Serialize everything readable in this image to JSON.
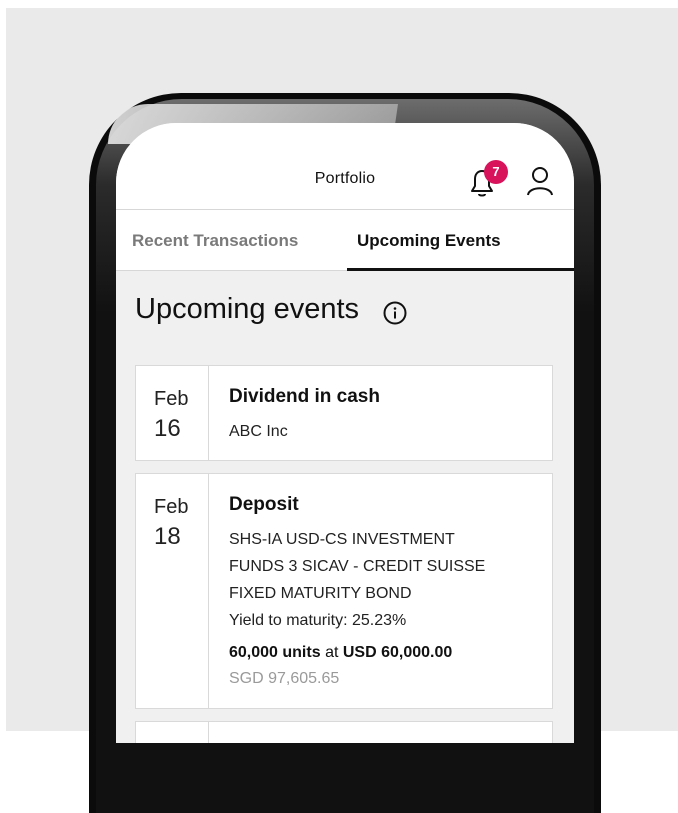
{
  "header": {
    "title": "Portfolio",
    "notification_count": "7"
  },
  "tabs": [
    {
      "label": "Recent Transactions",
      "active": false
    },
    {
      "label": "Upcoming Events",
      "active": true
    }
  ],
  "section": {
    "title": "Upcoming events"
  },
  "events": [
    {
      "month": "Feb",
      "day": "16",
      "title": "Dividend in cash",
      "lines": [
        "ABC Inc"
      ]
    },
    {
      "month": "Feb",
      "day": "18",
      "title": "Deposit",
      "lines": [
        "SHS-IA USD-CS INVESTMENT",
        "FUNDS 3 SICAV - CREDIT SUISSE",
        "FIXED MATURITY BOND"
      ],
      "yield": "Yield to maturity: 25.23%",
      "units": "60,000 units",
      "at": "at",
      "amount": "USD 60,000.00",
      "sgd": "SGD 97,605.65"
    }
  ],
  "colors": {
    "badge": "#d8125b",
    "active_tab": "#111111",
    "inactive_tab": "#7a7a7a"
  },
  "icons": [
    "bell-icon",
    "user-icon",
    "info-icon"
  ]
}
